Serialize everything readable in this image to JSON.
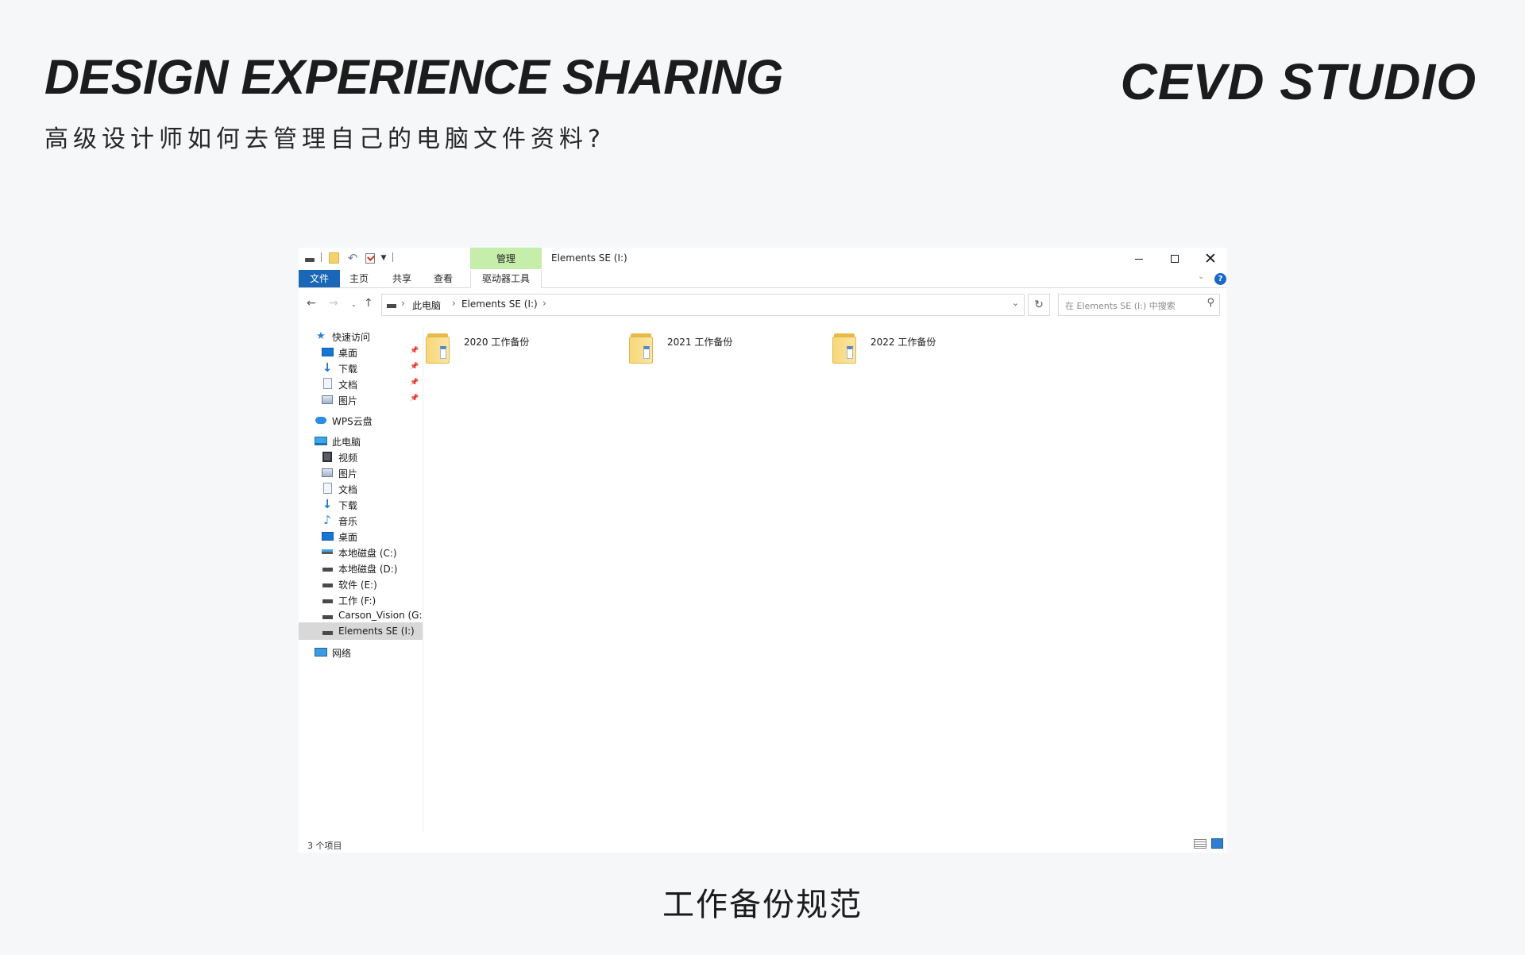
{
  "header": {
    "title": "DESIGN EXPERIENCE SHARING",
    "studio": "CEVD STUDIO",
    "subtitle": "高级设计师如何去管理自己的电脑文件资料?"
  },
  "caption": "工作备份规范",
  "explorer": {
    "window_title": "Elements SE (I:)",
    "quick_access": [
      "drive-icon",
      "folder-icon",
      "undo-icon",
      "properties-icon",
      "dropdown-icon"
    ],
    "context_tab_group": "管理",
    "ribbon_tabs": {
      "file": "文件",
      "home": "主页",
      "share": "共享",
      "view": "查看",
      "drive_tools": "驱动器工具"
    },
    "address": {
      "crumbs": [
        "此电脑",
        "Elements SE (I:)"
      ]
    },
    "search_placeholder": "在 Elements SE (I:) 中搜索",
    "sidebar": {
      "quick_access": "快速访问",
      "qa_items": [
        "桌面",
        "下载",
        "文档",
        "图片"
      ],
      "wps": "WPS云盘",
      "this_pc": "此电脑",
      "pc_items": [
        "视频",
        "图片",
        "文档",
        "下载",
        "音乐",
        "桌面"
      ],
      "drives": [
        "本地磁盘 (C:)",
        "本地磁盘 (D:)",
        "软件 (E:)",
        "工作 (F:)",
        "Carson_Vision (G:)",
        "Elements SE (I:)"
      ],
      "network": "网络"
    },
    "files": [
      "2020 工作备份",
      "2021 工作备份",
      "2022 工作备份"
    ],
    "status": "3 个项目",
    "colors": {
      "file_tab": "#1a67b8",
      "manage_tab": "#c6eeab",
      "selected_row": "#d8d8d8",
      "folder": "#f7d77a"
    }
  }
}
